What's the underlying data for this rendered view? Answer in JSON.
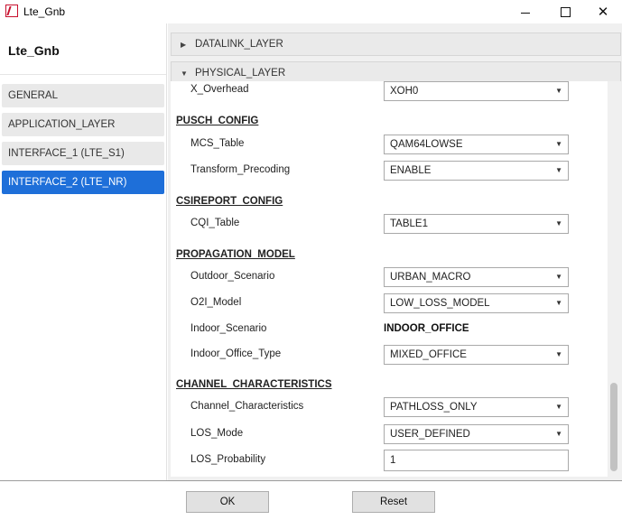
{
  "window": {
    "title": "Lte_Gnb",
    "icon": "app-logo-icon",
    "controls": {
      "minimize": "",
      "maximize": "",
      "close": "✕"
    }
  },
  "sidebar": {
    "title": "Lte_Gnb",
    "items": [
      {
        "label": "GENERAL",
        "active": false
      },
      {
        "label": "APPLICATION_LAYER",
        "active": false
      },
      {
        "label": "INTERFACE_1 (LTE_S1)",
        "active": false
      },
      {
        "label": "INTERFACE_2 (LTE_NR)",
        "active": true
      }
    ],
    "active_color": "#1e6fd9"
  },
  "sections": {
    "datalink": {
      "label": "DATALINK_LAYER",
      "expanded": false
    },
    "physical": {
      "label": "PHYSICAL_LAYER",
      "expanded": true
    }
  },
  "physical": {
    "x_overhead": {
      "label": "X_Overhead",
      "value": "XOH0"
    },
    "pusch_config": {
      "title": "PUSCH_CONFIG",
      "mcs_table": {
        "label": "MCS_Table",
        "value": "QAM64LOWSE"
      },
      "transform_precoding": {
        "label": "Transform_Precoding",
        "value": "ENABLE"
      }
    },
    "csireport_config": {
      "title": "CSIREPORT_CONFIG",
      "cqi_table": {
        "label": "CQI_Table",
        "value": "TABLE1"
      }
    },
    "propagation_model": {
      "title": "PROPAGATION_MODEL",
      "outdoor_scenario": {
        "label": "Outdoor_Scenario",
        "value": "URBAN_MACRO"
      },
      "o2i_model": {
        "label": "O2I_Model",
        "value": "LOW_LOSS_MODEL"
      },
      "indoor_scenario": {
        "label": "Indoor_Scenario",
        "value": "INDOOR_OFFICE"
      },
      "indoor_office_type": {
        "label": "Indoor_Office_Type",
        "value": "MIXED_OFFICE"
      }
    },
    "channel_characteristics": {
      "title": "CHANNEL_CHARACTERISTICS",
      "channel_characteristics": {
        "label": "Channel_Characteristics",
        "value": "PATHLOSS_ONLY"
      },
      "los_mode": {
        "label": "LOS_Mode",
        "value": "USER_DEFINED"
      },
      "los_probability": {
        "label": "LOS_Probability",
        "value": "1"
      }
    }
  },
  "footer": {
    "ok_label": "OK",
    "reset_label": "Reset"
  },
  "glyphs": {
    "collapsed": "▶",
    "expanded": "▼",
    "dropdown": "▼"
  }
}
